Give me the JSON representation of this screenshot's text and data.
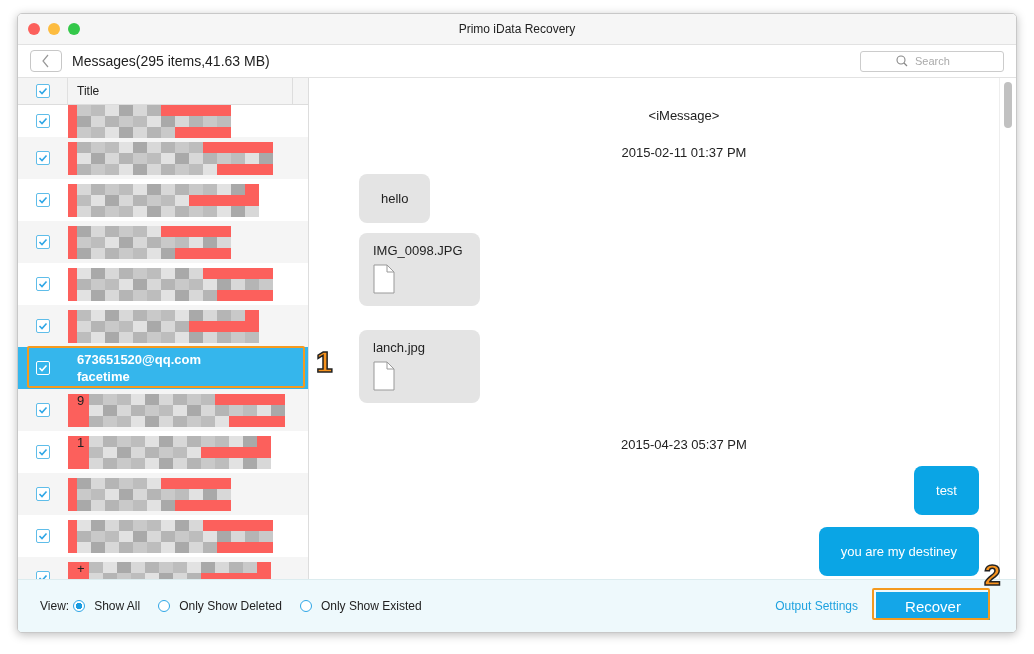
{
  "window": {
    "title": "Primo iData Recovery"
  },
  "toolbar": {
    "heading": "Messages(295 items,41.63 MB)",
    "search": {
      "placeholder": "Search"
    }
  },
  "list": {
    "header": {
      "title": "Title",
      "checked": true
    },
    "rows": [
      {
        "kind": "redacted",
        "checked": true,
        "selected": false
      },
      {
        "kind": "redacted",
        "checked": true,
        "selected": false
      },
      {
        "kind": "redacted",
        "checked": true,
        "selected": false
      },
      {
        "kind": "redacted",
        "checked": true,
        "selected": false
      },
      {
        "kind": "redacted",
        "checked": true,
        "selected": false
      },
      {
        "kind": "redacted",
        "checked": true,
        "selected": false
      },
      {
        "kind": "text",
        "checked": true,
        "selected": true,
        "title": "673651520@qq.com",
        "subtitle": "facetime"
      },
      {
        "kind": "redacted",
        "checked": true,
        "selected": false,
        "prefix": "9"
      },
      {
        "kind": "redacted",
        "checked": true,
        "selected": false,
        "prefix": "1"
      },
      {
        "kind": "redacted",
        "checked": true,
        "selected": false
      },
      {
        "kind": "redacted",
        "checked": true,
        "selected": false
      },
      {
        "kind": "redacted",
        "checked": true,
        "selected": false,
        "prefix": "+"
      }
    ]
  },
  "conversation": [
    {
      "kind": "service",
      "text": "<iMessage>"
    },
    {
      "kind": "time",
      "text": "2015-02-11 01:37 PM"
    },
    {
      "kind": "in",
      "text": "hello"
    },
    {
      "kind": "in-file",
      "text": "IMG_0098.JPG"
    },
    {
      "kind": "in-file",
      "text": "lanch.jpg"
    },
    {
      "kind": "time",
      "text": "2015-04-23 05:37 PM"
    },
    {
      "kind": "out",
      "text": "test"
    },
    {
      "kind": "out",
      "text": "you are my destiney"
    }
  ],
  "footer": {
    "view_label": "View:",
    "options": [
      {
        "label": "Show All",
        "selected": true
      },
      {
        "label": "Only Show Deleted",
        "selected": false
      },
      {
        "label": "Only Show Existed",
        "selected": false
      }
    ],
    "output_settings": "Output Settings",
    "recover": "Recover"
  },
  "annotations": [
    {
      "label": "1"
    },
    {
      "label": "2"
    }
  ]
}
